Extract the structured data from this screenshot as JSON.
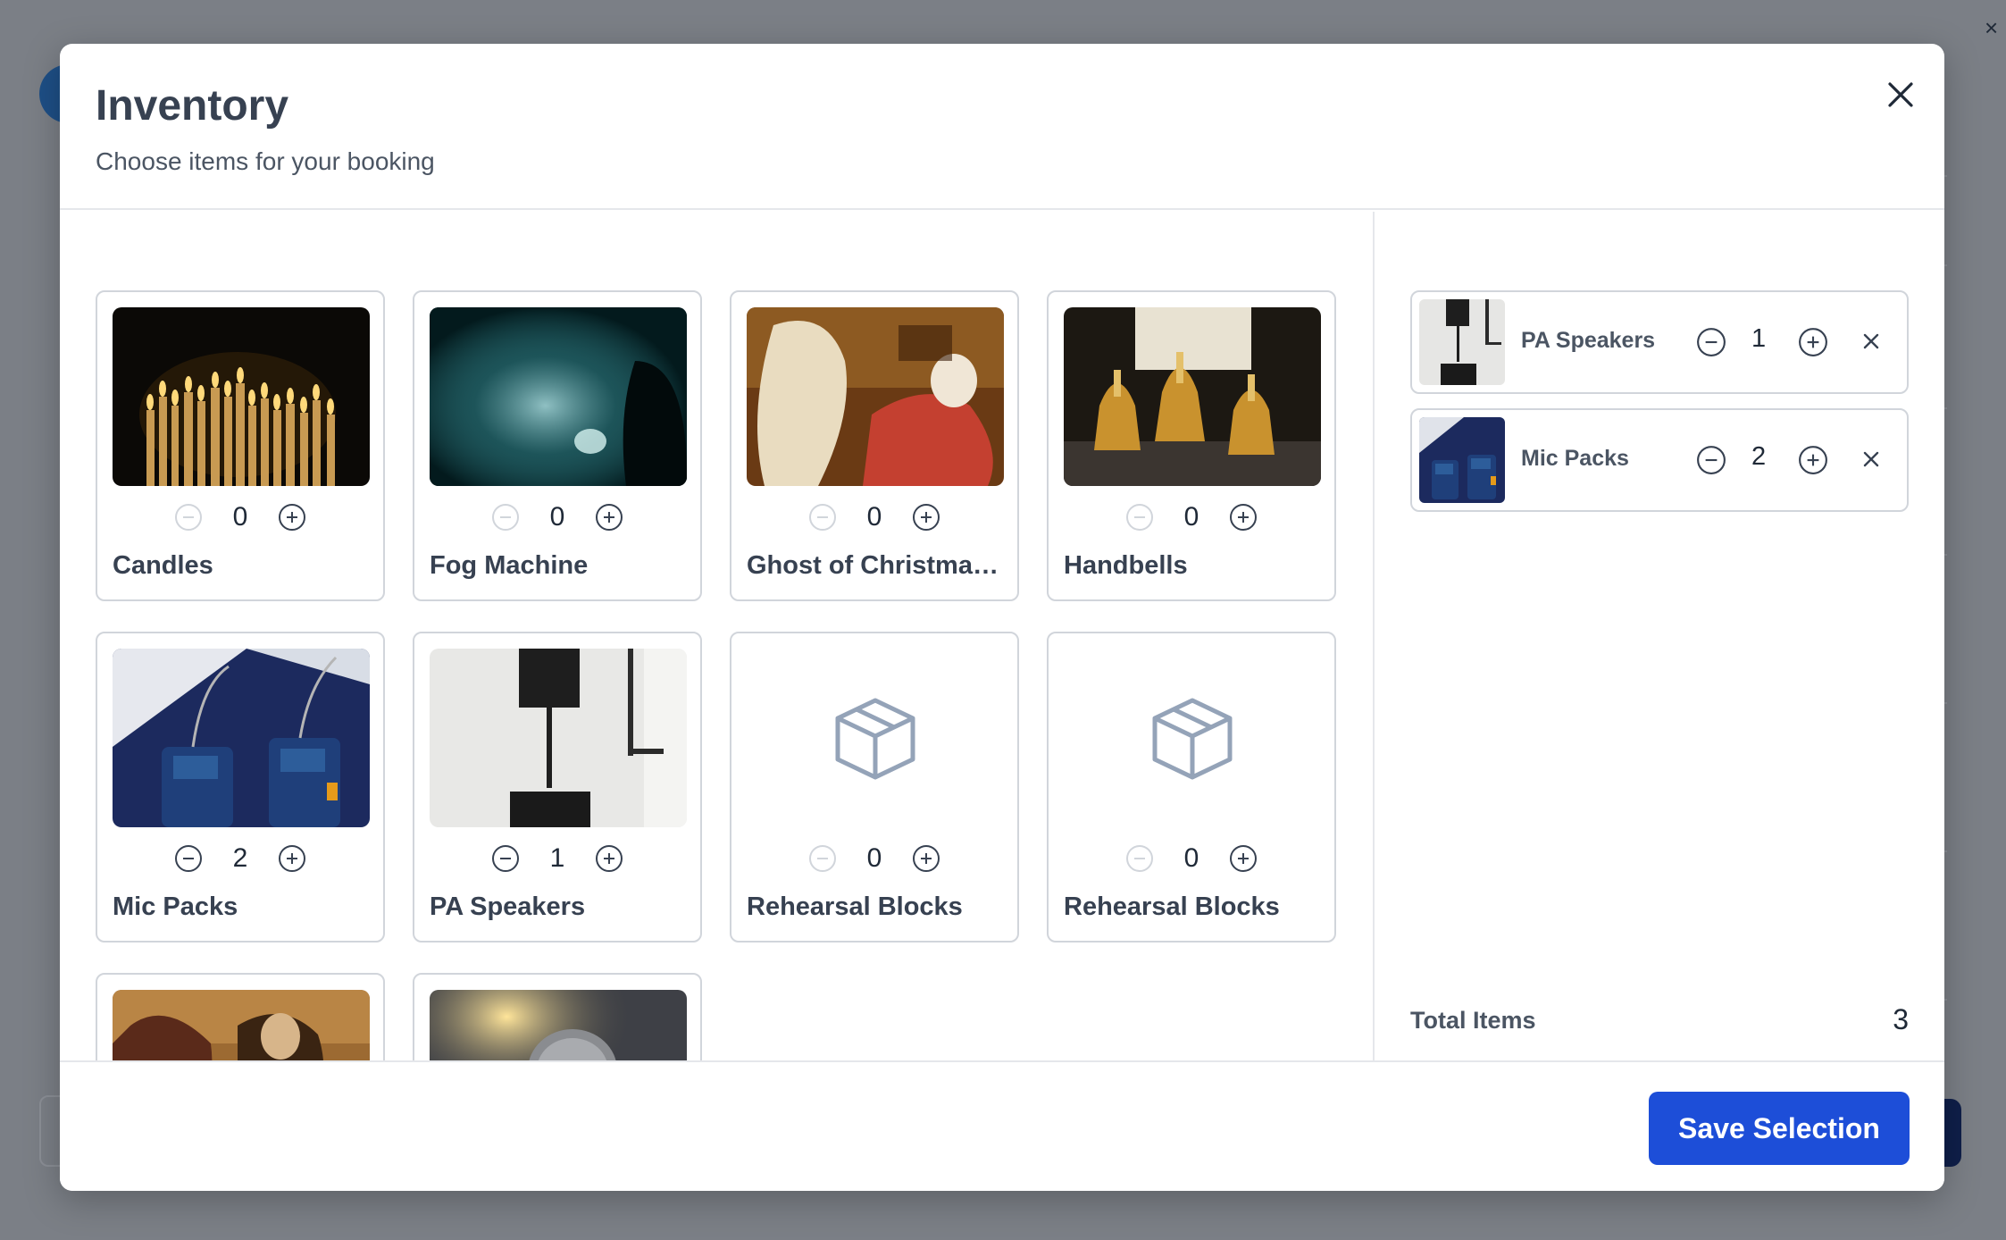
{
  "background": {
    "link_fragment": "m",
    "close_glyph": "×"
  },
  "modal": {
    "title": "Inventory",
    "subtitle": "Choose items for your booking",
    "close_icon": "close-icon"
  },
  "items": [
    {
      "name": "Candles",
      "quantity": "0",
      "image": "candles-photo"
    },
    {
      "name": "Fog Machine",
      "quantity": "0",
      "image": "fog-machine-photo"
    },
    {
      "name": "Ghost of Christmas...",
      "quantity": "0",
      "image": "ghost-painting-photo"
    },
    {
      "name": "Handbells",
      "quantity": "0",
      "image": "handbells-photo"
    },
    {
      "name": "Mic Packs",
      "quantity": "2",
      "image": "mic-packs-photo"
    },
    {
      "name": "PA Speakers",
      "quantity": "1",
      "image": "pa-speakers-photo"
    },
    {
      "name": "Rehearsal Blocks",
      "quantity": "0",
      "image": "box-icon"
    },
    {
      "name": "Rehearsal Blocks",
      "quantity": "0",
      "image": "box-icon"
    },
    {
      "name": "",
      "quantity": "",
      "image": "scrooge-illustration-photo"
    },
    {
      "name": "",
      "quantity": "",
      "image": "microphone-photo"
    }
  ],
  "selection": {
    "items": [
      {
        "name": "PA Speakers",
        "quantity": "1",
        "image": "pa-speakers-photo"
      },
      {
        "name": "Mic Packs",
        "quantity": "2",
        "image": "mic-packs-photo"
      }
    ],
    "total_label": "Total Items",
    "total_value": "3"
  },
  "footer": {
    "save_label": "Save Selection"
  },
  "colors": {
    "primary": "#1d4ed8",
    "overlay": "#7b7f86",
    "border": "#d1d5db"
  }
}
